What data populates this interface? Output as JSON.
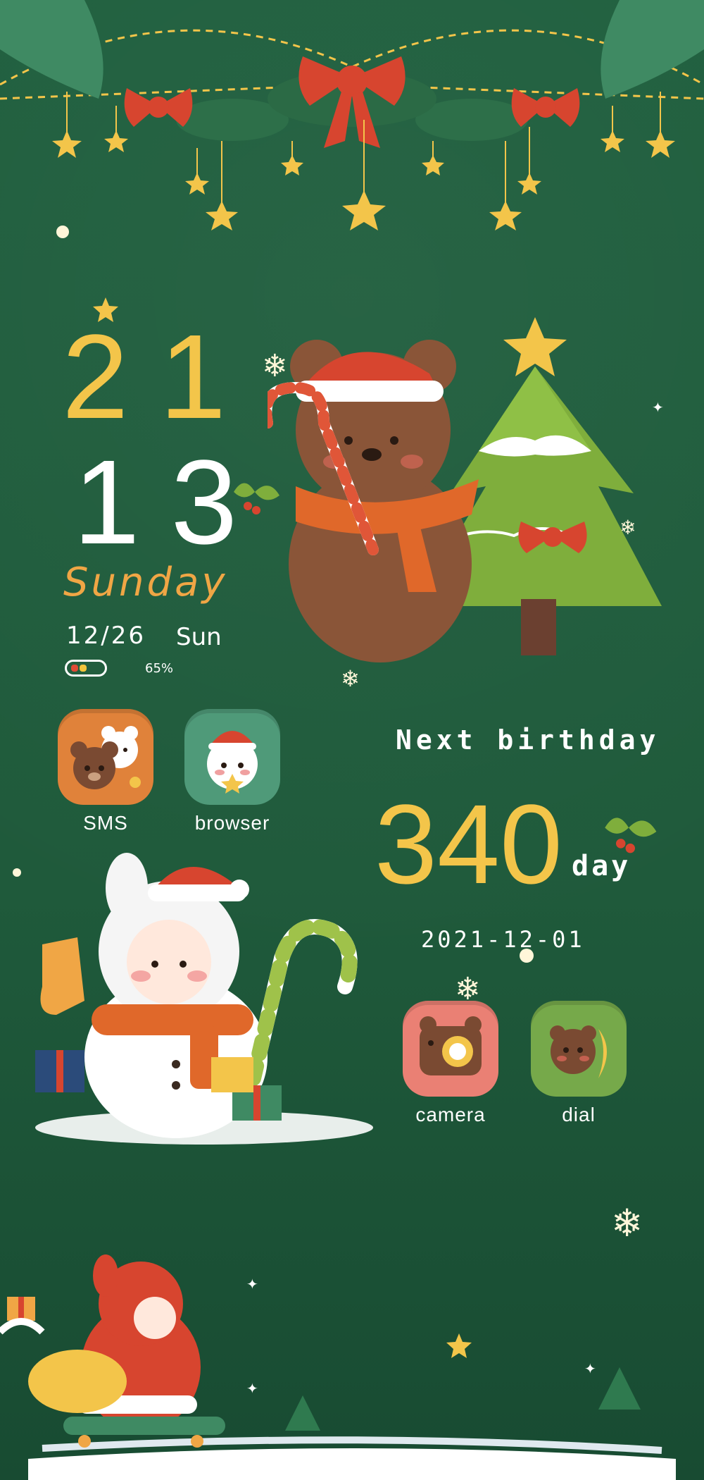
{
  "clock": {
    "hour": "21",
    "minute": "13",
    "day_name": "Sunday",
    "date": "12/26",
    "weekday_short": "Sun",
    "battery_percent_label": "65%",
    "battery_level": 0.65
  },
  "apps": [
    {
      "label": "SMS",
      "icon": "bear-bunny-duo-icon",
      "color": "#e0823a"
    },
    {
      "label": "browser",
      "icon": "santa-ghost-icon",
      "color": "#4f9a79"
    },
    {
      "label": "camera",
      "icon": "bear-camera-icon",
      "color": "#ea8074"
    },
    {
      "label": "dial",
      "icon": "bear-banana-icon",
      "color": "#76a94a"
    }
  ],
  "birthday_widget": {
    "title": "Next birthday",
    "count": "340",
    "unit": "day",
    "date": "2021-12-01"
  },
  "colors": {
    "background": "#1f5a3b",
    "accent_gold": "#f3c54a",
    "accent_orange": "#f0a645"
  }
}
